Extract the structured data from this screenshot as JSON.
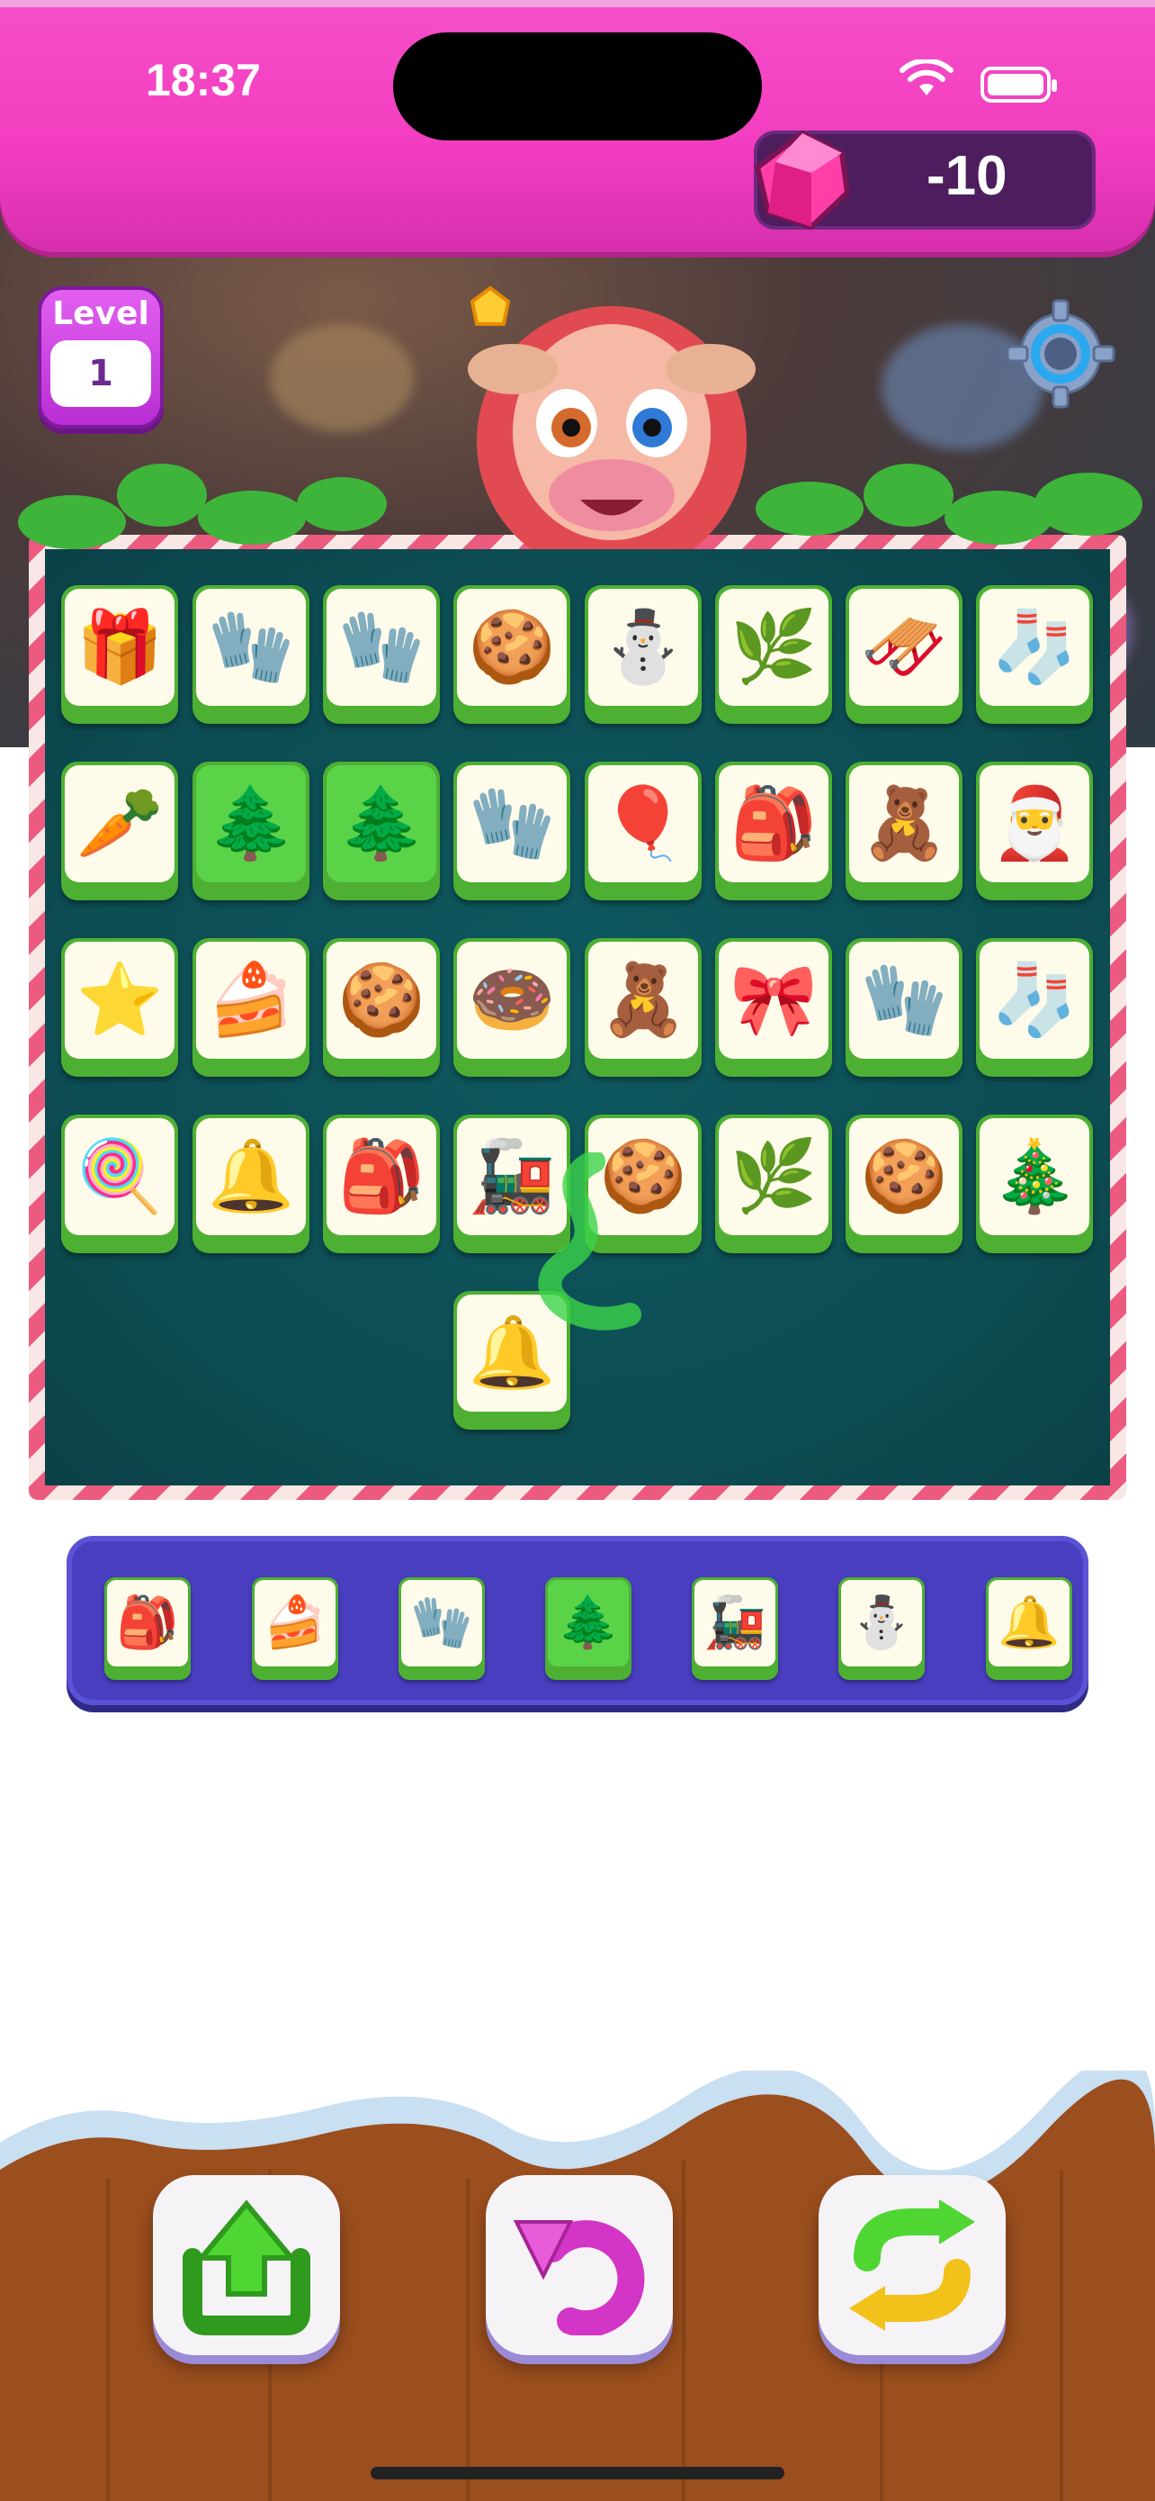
{
  "status_bar": {
    "time": "18:37"
  },
  "currency": {
    "gem_icon": "pink-gem-icon",
    "value": "-10"
  },
  "level": {
    "label": "Level",
    "number": "1"
  },
  "settings": {
    "icon": "gear-icon"
  },
  "board": {
    "rows": [
      [
        "🎁",
        "🧤",
        "🧤",
        "🍪",
        "⛄",
        "🌿",
        "🛷",
        "🧦"
      ],
      [
        "🥕",
        "🌲",
        "🌲",
        "🧤",
        "🎈",
        "🎒",
        "🧸",
        "🎅"
      ],
      [
        "⭐",
        "🍰",
        "🍪",
        "🍩",
        "🧸",
        "🎀",
        "🧤",
        "🧦"
      ],
      [
        "🍭",
        "🔔",
        "🎒",
        "🚂",
        "🍪",
        "🌿",
        "🍪",
        "🎄"
      ]
    ],
    "extra": [
      "🔔"
    ]
  },
  "tray": {
    "items": [
      "🎒",
      "🍰",
      "🧤",
      "🌲",
      "🚂",
      "⛄",
      "🔔"
    ]
  },
  "actions": [
    {
      "name": "undo-to-board",
      "icon": "upload-arrow-icon"
    },
    {
      "name": "undo",
      "icon": "undo-arrow-icon"
    },
    {
      "name": "shuffle",
      "icon": "shuffle-arrows-icon"
    }
  ]
}
